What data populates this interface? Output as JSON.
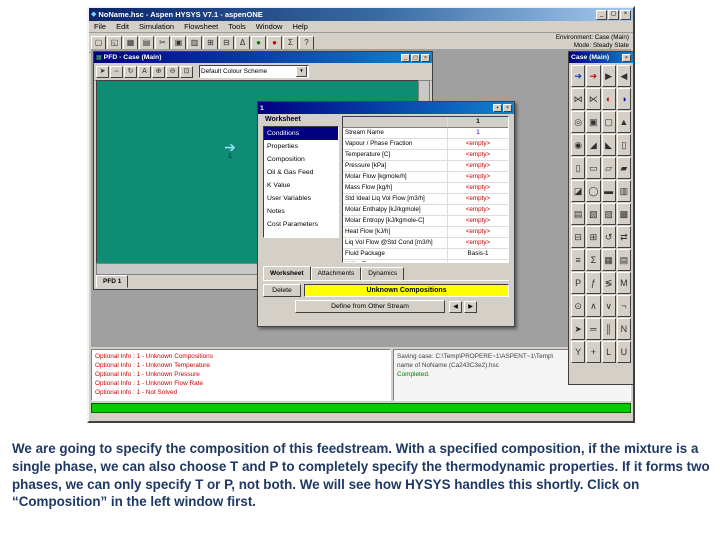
{
  "caption": "We are going to specify the composition of this feedstream. With a specified composition, if the mixture is a single phase, we can also choose T and P to completely specify the thermodynamic properties. If it forms two phases, we can only specify T or P, not both. We will see how HYSYS handles this shortly. Click on “Composition” in the left window first.",
  "colors": {
    "titlebar_start": "#0a246a",
    "titlebar_end": "#a6caf0",
    "pfd_canvas_green": "#0e8c74",
    "warning_yellow": "#ffff00",
    "empty_value_red": "#cc0000",
    "caption_navy": "#203864",
    "solver_green": "#00cc00"
  },
  "app": {
    "title": "NoName.hsc - Aspen HYSYS V7.1 - aspenONE",
    "app_icon": {
      "name": "app-icon",
      "glyph": "◆"
    },
    "window_buttons": [
      {
        "name": "minimize-button",
        "glyph": "_"
      },
      {
        "name": "maximize-button",
        "glyph": "▢"
      },
      {
        "name": "close-button",
        "glyph": "×"
      }
    ],
    "menu": [
      "File",
      "Edit",
      "Simulation",
      "Flowsheet",
      "Tools",
      "Window",
      "Help"
    ],
    "toolbar": [
      {
        "name": "new-case-button",
        "glyph": "▢"
      },
      {
        "name": "open-case-button",
        "glyph": "◱"
      },
      {
        "name": "save-case-button",
        "glyph": "▦"
      },
      {
        "name": "print-button",
        "glyph": "▤"
      },
      {
        "name": "cut-button",
        "glyph": "✂"
      },
      {
        "name": "copy-button",
        "glyph": "▣"
      },
      {
        "name": "paste-button",
        "glyph": "▥"
      },
      {
        "name": "workbook-button",
        "glyph": "⊞"
      },
      {
        "name": "pfd-button",
        "glyph": "⊟"
      },
      {
        "name": "basis-environment-button",
        "glyph": "Δ"
      },
      {
        "name": "solver-active-button",
        "glyph": "●",
        "color": "#008000"
      },
      {
        "name": "solver-hold-button",
        "glyph": "●",
        "color": "#cc0000"
      },
      {
        "name": "optimizer-button",
        "glyph": "Σ"
      },
      {
        "name": "help-button",
        "glyph": "?"
      }
    ],
    "environment_line": "Environment: Case (Main)",
    "mode_line": "Mode: Steady State",
    "pfd": {
      "title": "PFD - Case (Main)",
      "icon": {
        "name": "pfd-window-icon",
        "glyph": "▦"
      },
      "toolbar": [
        {
          "name": "cursor-button",
          "glyph": "➤"
        },
        {
          "name": "size-mode-button",
          "glyph": "⇔"
        },
        {
          "name": "rotate-button",
          "glyph": "↻"
        },
        {
          "name": "text-button",
          "glyph": "A"
        },
        {
          "name": "zoom-in-button",
          "glyph": "⊕"
        },
        {
          "name": "zoom-out-button",
          "glyph": "⊖"
        },
        {
          "name": "zoom-all-button",
          "glyph": "⊡"
        }
      ],
      "colour_scheme": "Default Colour Scheme",
      "combo_arrow": {
        "name": "chevron-down-icon",
        "glyph": "▼"
      },
      "stream_label": "1",
      "stream_arrow": {
        "name": "material-stream-arrow-icon",
        "glyph": "➔"
      },
      "tab": "PFD 1"
    },
    "property_view": {
      "title": "1",
      "buttons": [
        {
          "name": "pushpin-button",
          "glyph": "▪"
        },
        {
          "name": "close-button",
          "glyph": "×"
        }
      ],
      "pane_header": "Worksheet",
      "nav": [
        {
          "name": "nav-conditions",
          "label": "Conditions"
        },
        {
          "name": "nav-properties",
          "label": "Properties"
        },
        {
          "name": "nav-composition",
          "label": "Composition"
        },
        {
          "name": "nav-oil-gas-feed",
          "label": "Oil & Gas Feed"
        },
        {
          "name": "nav-k-value",
          "label": "K Value"
        },
        {
          "name": "nav-user-variables",
          "label": "User Variables"
        },
        {
          "name": "nav-notes",
          "label": "Notes"
        },
        {
          "name": "nav-cost-parameters",
          "label": "Cost Parameters"
        }
      ],
      "column_header": "1",
      "rows": [
        {
          "label": "Stream Name",
          "value": "1",
          "color": "#0000c0"
        },
        {
          "label": "Vapour / Phase Fraction",
          "value": "<empty>",
          "color": "#cc0000"
        },
        {
          "label": "Temperature [C]",
          "value": "<empty>",
          "color": "#cc0000"
        },
        {
          "label": "Pressure [kPa]",
          "value": "<empty>",
          "color": "#cc0000"
        },
        {
          "label": "Molar Flow [kgmole/h]",
          "value": "<empty>",
          "color": "#cc0000"
        },
        {
          "label": "Mass Flow [kg/h]",
          "value": "<empty>",
          "color": "#cc0000"
        },
        {
          "label": "Std Ideal Liq Vol Flow [m3/h]",
          "value": "<empty>",
          "color": "#cc0000"
        },
        {
          "label": "Molar Enthalpy [kJ/kgmole]",
          "value": "<empty>",
          "color": "#cc0000"
        },
        {
          "label": "Molar Entropy [kJ/kgmole-C]",
          "value": "<empty>",
          "color": "#cc0000"
        },
        {
          "label": "Heat Flow [kJ/h]",
          "value": "<empty>",
          "color": "#cc0000"
        },
        {
          "label": "Liq Vol Flow @Std Cond [m3/h]",
          "value": "<empty>",
          "color": "#cc0000"
        },
        {
          "label": "Fluid Package",
          "value": "Basis-1",
          "color": "#000000"
        },
        {
          "label": "Utility Type",
          "value": "",
          "color": "#000000"
        }
      ],
      "tabs": [
        "Worksheet",
        "Attachments",
        "Dynamics"
      ],
      "delete_label": "Delete",
      "status_text": "Unknown Compositions",
      "define_label": "Define from Other Stream",
      "nav_buttons": [
        {
          "name": "previous-object-button",
          "glyph": "◀"
        },
        {
          "name": "next-object-button",
          "glyph": "▶"
        }
      ]
    },
    "palette": {
      "title": "Case (Main)",
      "close_glyph": "×",
      "icons": [
        {
          "name": "material-stream-icon",
          "glyph": "➔",
          "color": "#0033cc"
        },
        {
          "name": "energy-stream-icon",
          "glyph": "➔",
          "color": "#cc0000"
        },
        {
          "name": "mixer-icon",
          "glyph": "▶"
        },
        {
          "name": "tee-icon",
          "glyph": "◀"
        },
        {
          "name": "valve-icon",
          "glyph": "⋈"
        },
        {
          "name": "relief-valve-icon",
          "glyph": "⋉"
        },
        {
          "name": "heater-icon",
          "glyph": "◐",
          "color": "#b00000"
        },
        {
          "name": "cooler-icon",
          "glyph": "◑",
          "color": "#0000b0"
        },
        {
          "name": "heat-exchanger-icon",
          "glyph": "◎"
        },
        {
          "name": "lng-exchanger-icon",
          "glyph": "▣"
        },
        {
          "name": "air-cooler-icon",
          "glyph": "▢"
        },
        {
          "name": "fired-heater-icon",
          "glyph": "▲"
        },
        {
          "name": "pump-icon",
          "glyph": "◉"
        },
        {
          "name": "compressor-icon",
          "glyph": "◢"
        },
        {
          "name": "expander-icon",
          "glyph": "◣"
        },
        {
          "name": "separator-icon",
          "glyph": "▯"
        },
        {
          "name": "three-phase-separator-icon",
          "glyph": "▯"
        },
        {
          "name": "tank-icon",
          "glyph": "▭"
        },
        {
          "name": "conversion-reactor-icon",
          "glyph": "▱"
        },
        {
          "name": "equilibrium-reactor-icon",
          "glyph": "▰"
        },
        {
          "name": "gibbs-reactor-icon",
          "glyph": "◪"
        },
        {
          "name": "cstr-icon",
          "glyph": "◯"
        },
        {
          "name": "pfr-icon",
          "glyph": "▬"
        },
        {
          "name": "distillation-column-icon",
          "glyph": "▥"
        },
        {
          "name": "absorber-icon",
          "glyph": "▤"
        },
        {
          "name": "refluxed-absorber-icon",
          "glyph": "▧"
        },
        {
          "name": "reboiled-absorber-icon",
          "glyph": "▨"
        },
        {
          "name": "liquid-liquid-extractor-icon",
          "glyph": "▩"
        },
        {
          "name": "component-splitter-icon",
          "glyph": "⊟"
        },
        {
          "name": "shortcut-column-icon",
          "glyph": "⊞"
        },
        {
          "name": "recycle-icon",
          "glyph": "↺"
        },
        {
          "name": "adjust-icon",
          "glyph": "⇄"
        },
        {
          "name": "set-icon",
          "glyph": "≡"
        },
        {
          "name": "balance-icon",
          "glyph": "Σ"
        },
        {
          "name": "spreadsheet-icon",
          "glyph": "▦"
        },
        {
          "name": "case-study-icon",
          "glyph": "▤"
        },
        {
          "name": "pid-controller-icon",
          "glyph": "P"
        },
        {
          "name": "transfer-function-icon",
          "glyph": "ƒ"
        },
        {
          "name": "selector-icon",
          "glyph": "≶"
        },
        {
          "name": "mpc-icon",
          "glyph": "M"
        },
        {
          "name": "digital-point-icon",
          "glyph": "⊙"
        },
        {
          "name": "boolean-and-icon",
          "glyph": "∧"
        },
        {
          "name": "boolean-or-icon",
          "glyph": "∨"
        },
        {
          "name": "boolean-not-icon",
          "glyph": "¬"
        },
        {
          "name": "virtual-stream-icon",
          "glyph": "➤"
        },
        {
          "name": "pipe-segment-icon",
          "glyph": "═"
        },
        {
          "name": "compressible-gas-pipe-icon",
          "glyph": "║"
        },
        {
          "name": "neural-net-icon",
          "glyph": "N"
        },
        {
          "name": "splitter-icon",
          "glyph": "Y"
        },
        {
          "name": "makeup-icon",
          "glyph": "+"
        },
        {
          "name": "latch-gate-icon",
          "glyph": "L"
        },
        {
          "name": "user-unit-op-icon",
          "glyph": "U"
        }
      ]
    },
    "status_pane": [
      {
        "text": "Optional Info : 1 - Unknown Compositions",
        "color": "#cc0000"
      },
      {
        "text": "Optional Info : 1 - Unknown Temperature",
        "color": "#cc0000"
      },
      {
        "text": "Optional Info : 1 - Unknown Pressure",
        "color": "#cc0000"
      },
      {
        "text": "Optional Info : 1 - Unknown Flow Rate",
        "color": "#cc0000"
      },
      {
        "text": "Optional Info : 1 - Not Solved",
        "color": "#cc0000"
      }
    ],
    "trace_pane": [
      {
        "text": "Saving case: C:\\Temp\\PROPERE~1\\ASPENT~1\\Temp\\",
        "color": "#404040"
      },
      {
        "text": "name of NoName (Ca243C3e2).hsc",
        "color": "#404040"
      },
      {
        "text": "Completed.",
        "color": "#008000"
      }
    ]
  }
}
